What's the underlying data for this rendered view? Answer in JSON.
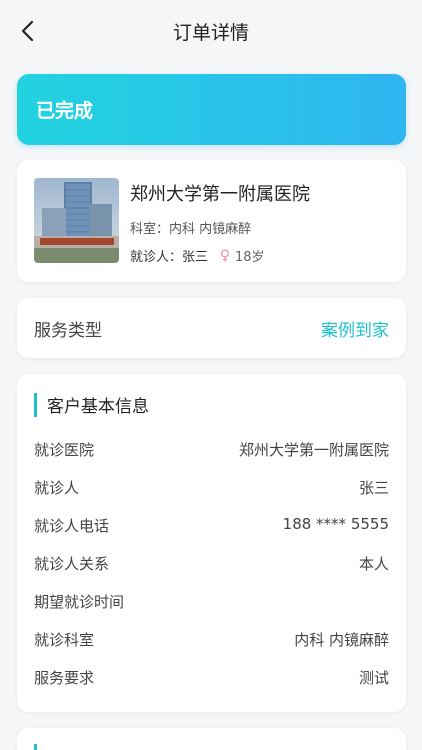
{
  "header": {
    "title": "订单详情"
  },
  "status": {
    "label": "已完成"
  },
  "hospital_card": {
    "name": "郑州大学第一附属医院",
    "department": "科室：内科 内镜麻醉",
    "patient": "就诊人：张三",
    "age": "18岁"
  },
  "service": {
    "label": "服务类型",
    "value": "案例到家"
  },
  "customer_info": {
    "title": "客户基本信息",
    "rows": [
      {
        "label": "就诊医院",
        "value": "郑州大学第一附属医院"
      },
      {
        "label": "就诊人",
        "value": "张三"
      },
      {
        "label": "就诊人电话",
        "value": "188 **** 5555"
      },
      {
        "label": "就诊人关系",
        "value": "本人"
      },
      {
        "label": "期望就诊时间",
        "value": ""
      },
      {
        "label": "就诊科室",
        "value": "内科 内镜麻醉"
      },
      {
        "label": "服务要求",
        "value": "测试"
      }
    ]
  },
  "colors": {
    "accent": "#1fc1cc",
    "banner_start": "#22d3e0",
    "banner_end": "#2fb6f0"
  }
}
